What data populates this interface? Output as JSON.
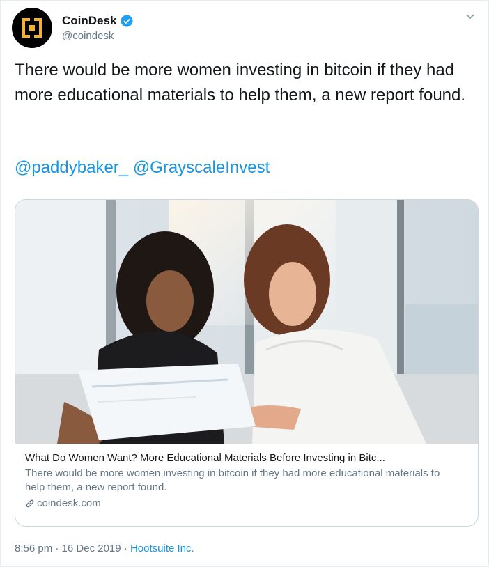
{
  "author": {
    "display_name": "CoinDesk",
    "handle": "@coindesk",
    "avatar_icon": "coindesk-logo-icon",
    "verified_icon": "verified-badge-icon"
  },
  "tweet": {
    "text": "There would be more women investing in bitcoin if they had more educational materials to help them, a new report found.",
    "mentions": [
      "@paddybaker_",
      "@GrayscaleInvest"
    ]
  },
  "card": {
    "image_description_icon": "article-photo",
    "title": "What Do Women Want? More Educational Materials Before Investing in Bitc...",
    "description": "There would be more women investing in bitcoin if they had more educational materials to help them, a new report found.",
    "domain": "coindesk.com"
  },
  "footer": {
    "time": "8:56 pm",
    "separator": "·",
    "date": "16 Dec 2019",
    "source": "Hootsuite Inc."
  },
  "colors": {
    "link": "#1b95e0",
    "muted": "#657786",
    "verified": "#1da1f2",
    "logo_gold": "#f2b134"
  }
}
